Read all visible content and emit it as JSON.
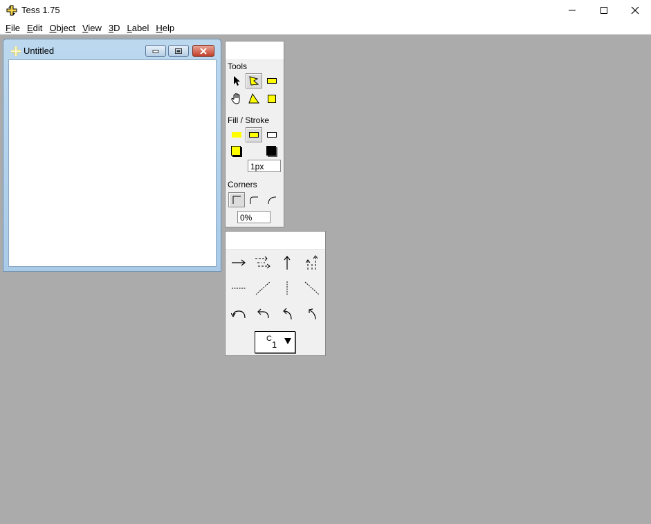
{
  "app": {
    "title": "Tess 1.75",
    "icon": "tess-app-icon"
  },
  "window_controls": {
    "minimize": "minimize-icon",
    "maximize": "maximize-icon",
    "close": "close-icon"
  },
  "menu": [
    {
      "accel": "F",
      "rest": "ile"
    },
    {
      "accel": "E",
      "rest": "dit"
    },
    {
      "accel": "O",
      "rest": "bject"
    },
    {
      "accel": "V",
      "rest": "iew"
    },
    {
      "accel": "3",
      "rest": "D"
    },
    {
      "accel": "L",
      "rest": "abel"
    },
    {
      "accel": "H",
      "rest": "elp"
    }
  ],
  "document": {
    "title": "Untitled"
  },
  "tool_palette": {
    "tools_label": "Tools",
    "fill_stroke_label": "Fill / Stroke",
    "stroke_width": "1px",
    "corners_label": "Corners",
    "corner_radius": "0%"
  },
  "arrow_palette": {
    "label_select_value": "C",
    "label_select_subscript": "1"
  },
  "colors": {
    "desktop": "#ababab",
    "fill_yellow": "#ffff00",
    "palette_bg": "#f0f0f0"
  }
}
